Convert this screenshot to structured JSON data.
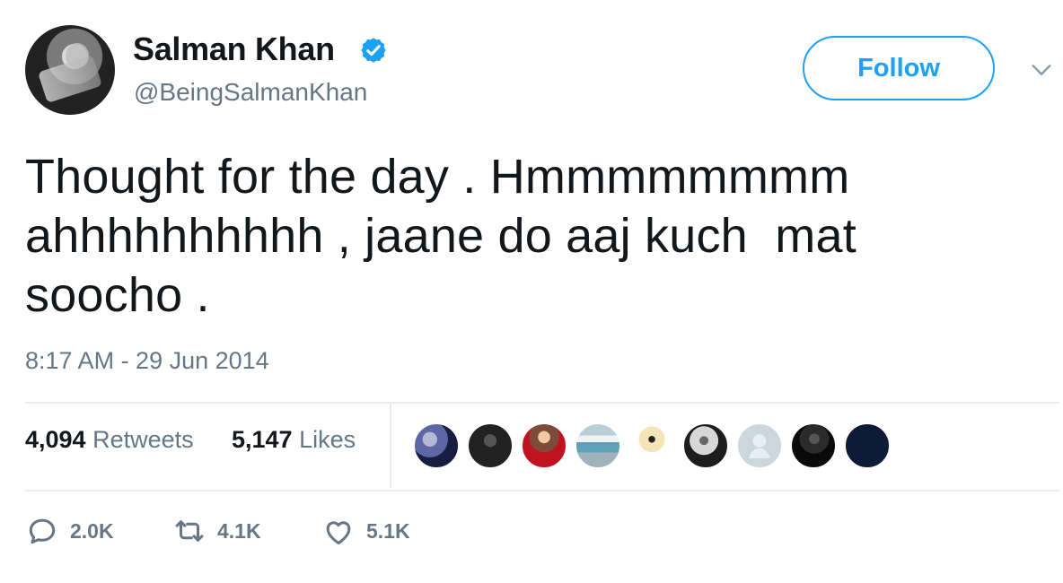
{
  "user": {
    "name": "Salman Khan",
    "handle": "@BeingSalmanKhan",
    "verified": true
  },
  "header": {
    "follow_label": "Follow"
  },
  "tweet": {
    "text": "Thought for the day . Hmmmmmmmm\nahhhhhhhhhh , jaane do aaj kuch  mat\nsoocho .",
    "timestamp": "8:17 AM - 29 Jun 2014"
  },
  "stats": {
    "retweets_count": "4,094",
    "retweets_label": "Retweets",
    "likes_count": "5,147",
    "likes_label": "Likes"
  },
  "actions": {
    "reply_count": "2.0K",
    "retweet_count": "4.1K",
    "like_count": "5.1K"
  },
  "colors": {
    "accent": "#1da1f2",
    "muted_text": "#657786",
    "primary_text": "#14171a",
    "divider": "#e6ecf0"
  },
  "icons": {
    "verified": "verified-badge-icon",
    "more": "chevron-down-icon",
    "reply": "reply-icon",
    "retweet": "retweet-icon",
    "like": "heart-icon"
  }
}
